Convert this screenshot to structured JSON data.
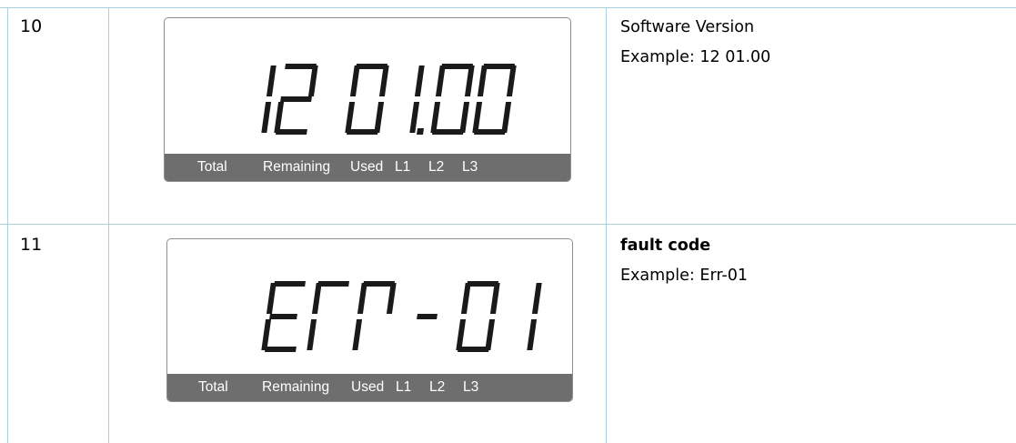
{
  "rows": [
    {
      "number": "10",
      "display_value": "12 01.00",
      "indicator_labels": [
        "Total",
        "Remaining",
        "Used",
        "L1",
        "L2",
        "L3"
      ],
      "description_title": "Software Version",
      "description_example": "Example: 12 01.00"
    },
    {
      "number": "11",
      "display_value": "Err-01",
      "indicator_labels": [
        "Total",
        "Remaining",
        "Used",
        "L1",
        "L2",
        "L3"
      ],
      "description_title": "fault code",
      "description_example": "Example: Err-01"
    }
  ]
}
